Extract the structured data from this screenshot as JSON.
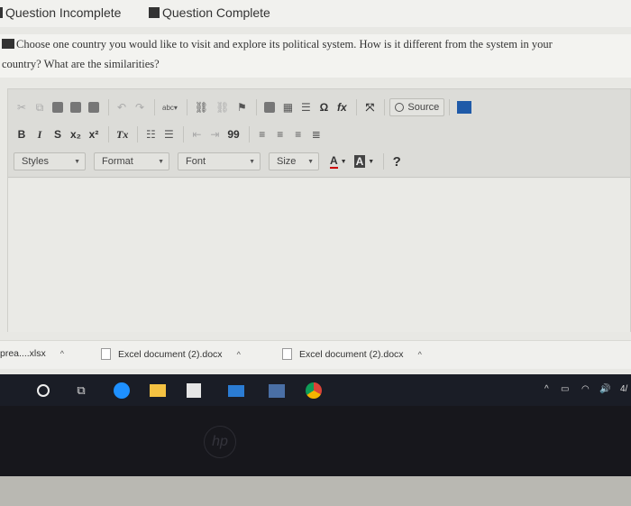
{
  "legend": {
    "incomplete": "Question Incomplete",
    "complete": "Question Complete"
  },
  "question": {
    "line1": "Choose one country you would like to visit and explore its political system. How is it different from the system in your",
    "line2": "country? What are the similarities?"
  },
  "toolbar": {
    "source_label": "Source",
    "styles_label": "Styles",
    "format_label": "Format",
    "font_label": "Font",
    "size_label": "Size",
    "text_color_label": "A",
    "bg_color_label": "A",
    "help_label": "?",
    "bold": "B",
    "italic": "I",
    "strike": "S",
    "subscript": "x₂",
    "superscript": "x²",
    "clear_format": "Tx",
    "blockquote": "99",
    "omega": "Ω",
    "fx": "fx"
  },
  "downloads": [
    {
      "name": "prea....xlsx"
    },
    {
      "name": "Excel document (2).docx"
    },
    {
      "name": "Excel document (2).docx"
    }
  ],
  "taskbar": {
    "tray_clock": "4/"
  },
  "bezel": {
    "logo_text": "hp"
  },
  "colors": {
    "taskbar_bg": "#1a1d26",
    "edge_blue": "#1e90ff",
    "chrome_red": "#db4437",
    "chrome_yellow": "#f4b400",
    "chrome_green": "#0f9d58"
  }
}
